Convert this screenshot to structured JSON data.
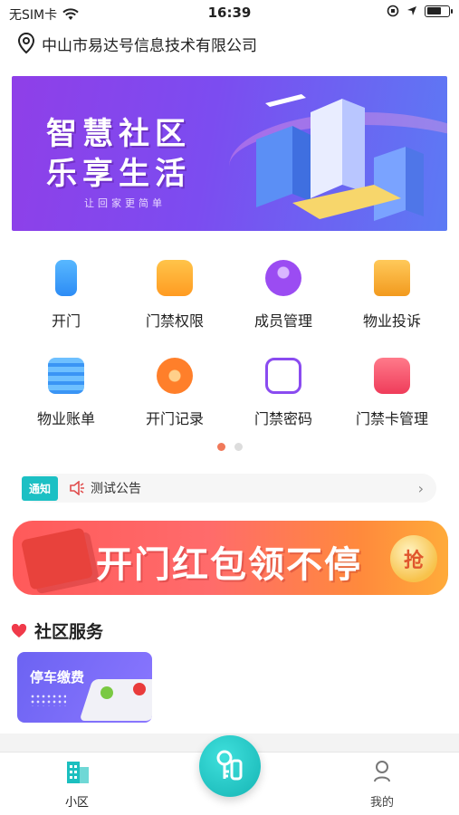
{
  "status_bar": {
    "carrier": "无SIM卡",
    "time": "16:39"
  },
  "location": {
    "name": "中山市易达号信息技术有限公司"
  },
  "banner": {
    "line1": "智慧社区",
    "line2": "乐享生活",
    "subtitle": "让回家更简单"
  },
  "grid": {
    "items": [
      {
        "label": "开门",
        "icon": "phone-nfc-icon",
        "color": "#3aa6ff"
      },
      {
        "label": "门禁权限",
        "icon": "access-permission-icon",
        "color": "#ffad2e"
      },
      {
        "label": "成员管理",
        "icon": "member-icon",
        "color": "#9b4cf2"
      },
      {
        "label": "物业投诉",
        "icon": "vote-box-icon",
        "color": "#f2a024"
      },
      {
        "label": "物业账单",
        "icon": "bill-icon",
        "color": "#3aa0ff"
      },
      {
        "label": "开门记录",
        "icon": "record-icon",
        "color": "#ff8a2b"
      },
      {
        "label": "门禁密码",
        "icon": "password-icon",
        "color": "#8a4bf0"
      },
      {
        "label": "门禁卡管理",
        "icon": "card-icon",
        "color": "#f45168"
      }
    ],
    "pages": 2,
    "active_page": 1
  },
  "notice": {
    "tag": "通知",
    "text": "测试公告"
  },
  "promo": {
    "text": "开门红包领不停",
    "badge": "抢"
  },
  "community": {
    "title": "社区服务",
    "services": [
      {
        "label": "停车缴费"
      }
    ]
  },
  "tabbar": {
    "home_label": "小区",
    "mine_label": "我的"
  }
}
